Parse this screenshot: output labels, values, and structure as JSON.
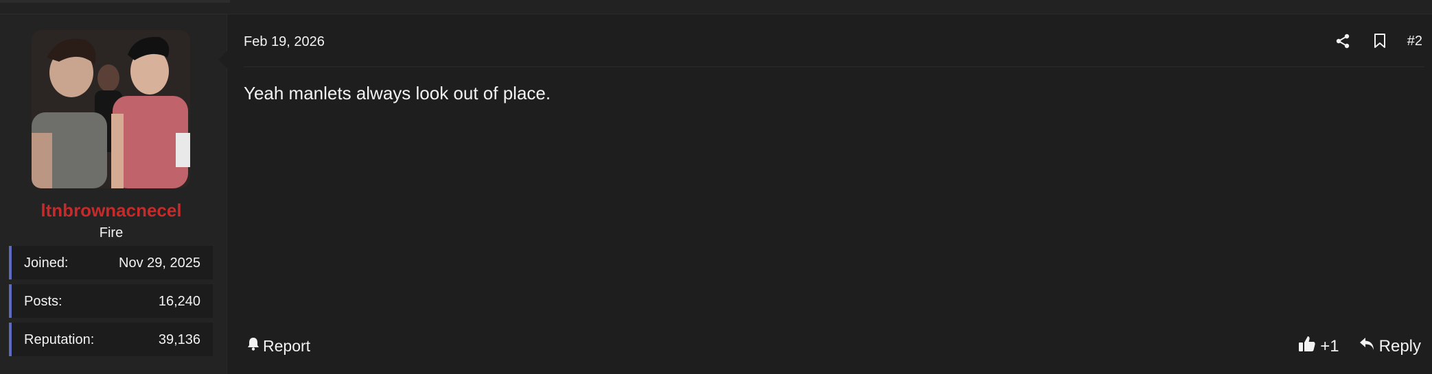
{
  "post": {
    "user": {
      "username": "ltnbrownacnecel",
      "title": "Fire",
      "username_color": "#c62a2a",
      "stats": [
        {
          "label": "Joined:",
          "value": "Nov 29, 2025"
        },
        {
          "label": "Posts:",
          "value": "16,240"
        },
        {
          "label": "Reputation:",
          "value": "39,136"
        }
      ]
    },
    "date": "Feb 19, 2026",
    "number": "#2",
    "message": "Yeah manlets always look out of place.",
    "actions": {
      "report_label": "Report",
      "like_count": "+1",
      "reply_label": "Reply"
    },
    "icons": {
      "share": "share-icon",
      "bookmark": "bookmark-icon",
      "report": "bell-icon",
      "like": "thumbs-up-icon",
      "reply": "reply-arrow-icon"
    },
    "colors": {
      "background": "#1e1e1e",
      "user_panel": "#232323",
      "stat_accent": "#5c6bc0"
    }
  }
}
